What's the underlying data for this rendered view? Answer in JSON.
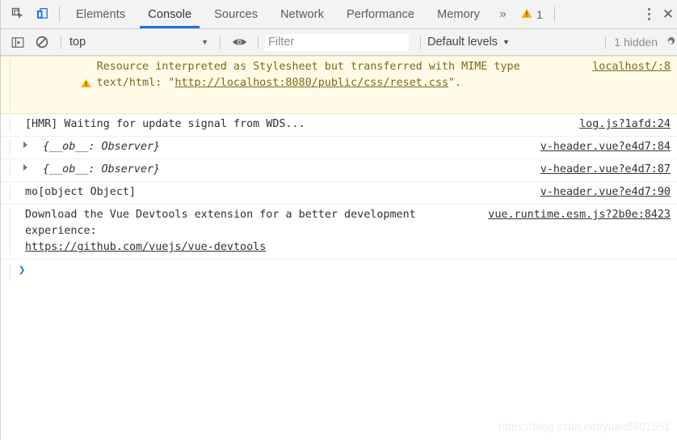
{
  "toolbar": {
    "inspect_icon": "inspect-element-icon",
    "device_icon": "device-toolbar-icon",
    "tabs": [
      {
        "label": "Elements",
        "active": false
      },
      {
        "label": "Console",
        "active": true
      },
      {
        "label": "Sources",
        "active": false
      },
      {
        "label": "Network",
        "active": false
      },
      {
        "label": "Performance",
        "active": false
      },
      {
        "label": "Memory",
        "active": false
      }
    ],
    "overflow_label": "»",
    "warning_count": "1",
    "warning_icon": "warning-triangle-icon",
    "menu_icon": "kebab-menu-icon",
    "close_label": "✕"
  },
  "filterbar": {
    "sidebar_icon": "console-sidebar-icon",
    "clear_icon": "clear-console-icon",
    "context": "top",
    "context_caret": "▼",
    "eye_icon": "live-expression-eye-icon",
    "filter_placeholder": "Filter",
    "filter_value": "",
    "levels_label": "Default levels",
    "levels_caret": "▼",
    "hidden_label": "1 hidden",
    "settings_icon": "settings-gear-icon"
  },
  "console": {
    "messages": [
      {
        "type": "warning",
        "text_before": "Resource interpreted as Stylesheet but transferred with MIME type text/html: \"",
        "link": "http://localhost:8080/public/css/reset.css",
        "text_after": "\".",
        "source": "localhost/:8"
      },
      {
        "type": "log",
        "text": "[HMR] Waiting for update signal from WDS...",
        "source": "log.js?1afd:24"
      },
      {
        "type": "object",
        "text": "{__ob__: Observer}",
        "source": "v-header.vue?e4d7:84"
      },
      {
        "type": "object",
        "text": "{__ob__: Observer}",
        "source": "v-header.vue?e4d7:87"
      },
      {
        "type": "log",
        "text": "mo[object Object]",
        "source": "v-header.vue?e4d7:90"
      },
      {
        "type": "multiline",
        "text_before": "Download the Vue Devtools extension for a better development experience:\n",
        "link": "https://github.com/vuejs/vue-devtools",
        "text_after": "",
        "source": "vue.runtime.esm.js?2b0e:8423"
      }
    ],
    "prompt_caret": "❯",
    "prompt_value": ""
  },
  "watermark": "https://blog.csdn.net/yuan5801551",
  "colors": {
    "accent": "#1a73e8",
    "warning_bg": "#fffbe6",
    "warning_text": "#7c6a18",
    "warning_icon": "#f0b400",
    "toolbar_bg": "#f3f3f3"
  }
}
